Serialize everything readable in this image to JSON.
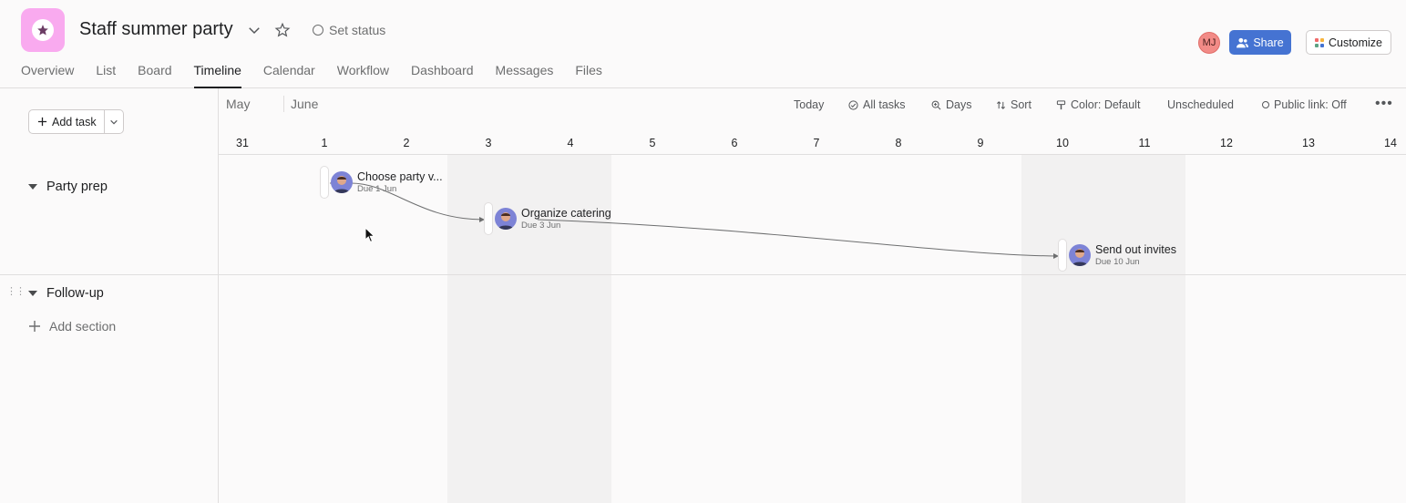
{
  "header": {
    "project_title": "Staff summer party",
    "set_status": "Set status",
    "tabs": [
      {
        "label": "Overview"
      },
      {
        "label": "List"
      },
      {
        "label": "Board"
      },
      {
        "label": "Timeline",
        "active": true
      },
      {
        "label": "Calendar"
      },
      {
        "label": "Workflow"
      },
      {
        "label": "Dashboard"
      },
      {
        "label": "Messages"
      },
      {
        "label": "Files"
      }
    ],
    "avatar_initials": "MJ",
    "share_label": "Share",
    "customize_label": "Customize"
  },
  "colors": {
    "project_icon": "#f9aaef",
    "share": "#4573d2",
    "avatar": "#f28b87",
    "customize_grid": [
      "#f06a6a",
      "#f8b43c",
      "#5da283",
      "#4573d2"
    ]
  },
  "toolbar": {
    "add_task": "Add task",
    "today": "Today",
    "all_tasks": "All tasks",
    "days": "Days",
    "sort": "Sort",
    "color": "Color: Default",
    "unscheduled": "Unscheduled",
    "public_link": "Public link: Off"
  },
  "timeline": {
    "months": [
      "May",
      "June"
    ],
    "days": [
      "31",
      "1",
      "2",
      "3",
      "4",
      "5",
      "6",
      "7",
      "8",
      "9",
      "10",
      "11",
      "12",
      "13",
      "14"
    ]
  },
  "sections": [
    {
      "name": "Party prep",
      "tasks": [
        {
          "name": "Choose party v...",
          "due": "Due 1 Jun"
        },
        {
          "name": "Organize catering",
          "due": "Due 3 Jun"
        },
        {
          "name": "Send out invites",
          "due": "Due 10 Jun"
        }
      ]
    },
    {
      "name": "Follow-up",
      "tasks": []
    }
  ],
  "add_section": "Add section"
}
